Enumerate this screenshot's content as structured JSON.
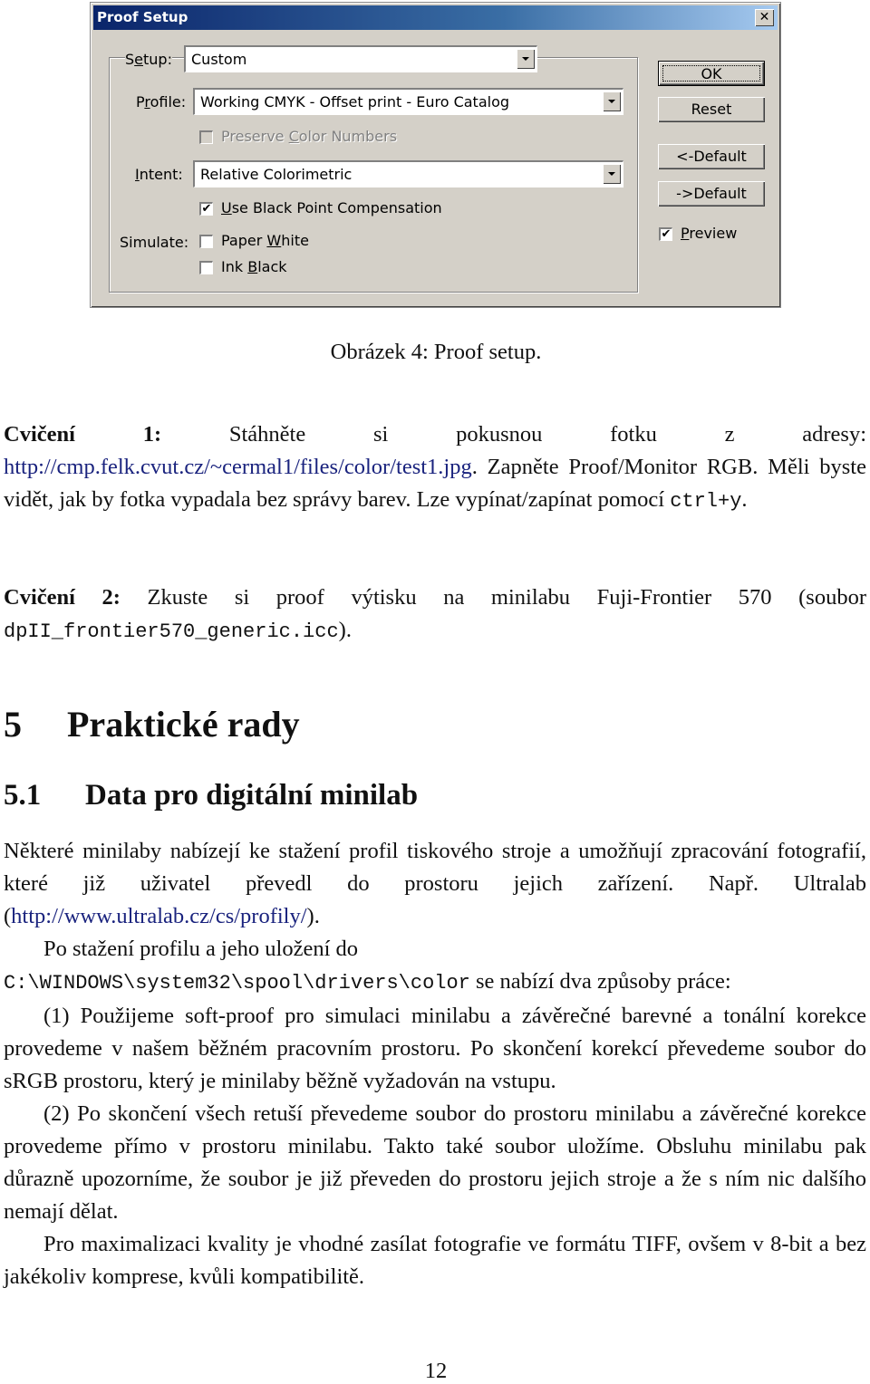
{
  "dialog": {
    "title": "Proof Setup",
    "close_label": "✕",
    "setup": {
      "label_pre": "S",
      "label_u": "e",
      "label_post": "tup:",
      "value": "Custom"
    },
    "profile": {
      "label_pre": "P",
      "label_u": "r",
      "label_post": "ofile:",
      "value": "Working CMYK - Offset print - Euro Catalog"
    },
    "preserve_color_numbers": {
      "label_pre": "Preserve ",
      "label_u": "C",
      "label_post": "olor Numbers",
      "checked": false,
      "disabled": true
    },
    "intent": {
      "label_pre": "",
      "label_u": "I",
      "label_post": "ntent:",
      "value": "Relative Colorimetric"
    },
    "black_point": {
      "label_pre": "",
      "label_u": "U",
      "label_post": "se Black Point Compensation",
      "checked": true
    },
    "simulate_label": "Simulate:",
    "paper_white": {
      "label_pre": "Paper ",
      "label_u": "W",
      "label_post": "hite",
      "checked": false
    },
    "ink_black": {
      "label_pre": "Ink ",
      "label_u": "B",
      "label_post": "lack",
      "checked": false
    },
    "buttons": {
      "ok": "OK",
      "reset": "Reset",
      "load_default": "<-Default",
      "save_default": "->Default"
    },
    "preview": {
      "label_pre": "",
      "label_u": "P",
      "label_post": "review",
      "checked": true
    },
    "check_glyph": "✔"
  },
  "caption": "Obrázek 4: Proof setup.",
  "exercise1": {
    "bold": "Cvičení 1:",
    "text1": " Stáhněte si pokusnou fotku z adresy: ",
    "link": "http://cmp.felk.cvut.cz/~cermal1/files/color/test1.jpg",
    "text2": ". Zapněte Proof/Monitor RGB. Měli byste vidět, jak by fotka vypadala bez správy barev. Lze vypínat/zapínat pomocí ",
    "code": "ctrl+y",
    "text3": "."
  },
  "exercise2": {
    "bold": "Cvičení 2:",
    "text1": " Zkuste si proof výtisku na minilabu Fuji-Frontier 570 (soubor ",
    "code": "dpII_frontier570_generic.icc",
    "text2": ")."
  },
  "section": {
    "number": "5",
    "title": "Praktické rady"
  },
  "subsection": {
    "number": "5.1",
    "title": "Data pro digitální minilab"
  },
  "paragraphs": {
    "p1_text": "Některé minilaby nabízejí ke stažení profil tiskového stroje a umožňují zpracování fotografií, které již uživatel převedl do prostoru jejich zařízení. Např. Ultralab (",
    "p1_link": "http://www.ultralab.cz/cs/profily/",
    "p1_end": ").",
    "p2_text": "Po stažení profilu a jeho uložení do",
    "p2_code": "C:\\WINDOWS\\system32\\spool\\drivers\\color",
    "p2_end": " se nabízí dva způsoby práce:",
    "p3": "(1) Použijeme soft-proof pro simulaci minilabu a závěrečné barevné a tonální korekce provedeme v našem běžném pracovním prostoru. Po skončení korekcí převedeme soubor do sRGB prostoru, který je minilaby běžně vyžadován na vstupu.",
    "p4": "(2) Po skončení všech retuší převedeme soubor do prostoru minilabu a závěrečné korekce provedeme přímo v prostoru minilabu. Takto také soubor uložíme. Obsluhu minilabu pak důrazně upozorníme, že soubor je již převeden do prostoru jejich stroje a že s ním nic dalšího nemají dělat.",
    "p5": "Pro maximalizaci kvality je vhodné zasílat fotografie ve formátu TIFF, ovšem v 8-bit a bez jakékoliv komprese, kvůli kompatibilitě."
  },
  "page_number": "12"
}
